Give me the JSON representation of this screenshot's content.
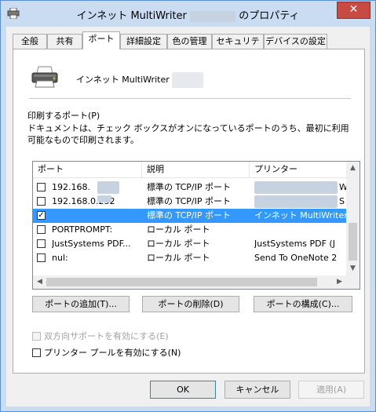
{
  "window": {
    "title_prefix": "インネット MultiWriter",
    "title_suffix": "のプロパティ",
    "close_symbol": "✕"
  },
  "tabs": [
    {
      "label": "全般"
    },
    {
      "label": "共有"
    },
    {
      "label": "ポート"
    },
    {
      "label": "詳細設定"
    },
    {
      "label": "色の管理"
    },
    {
      "label": "セキュリティ"
    },
    {
      "label": "デバイスの設定"
    }
  ],
  "printer": {
    "name": "インネット MultiWriter"
  },
  "ports_section": {
    "label": "印刷するポート(P)",
    "description": "ドキュメントは、チェック ボックスがオンになっているポートのうち、最初に利用可能なもので印刷されます。"
  },
  "port_list": {
    "headers": [
      "ポート",
      "説明",
      "プリンター"
    ],
    "rows": [
      {
        "checked": false,
        "selected": false,
        "port": "192.168.",
        "desc": "標準の TCP/IP ポート",
        "printer": "W"
      },
      {
        "checked": false,
        "selected": false,
        "port": "192.168.0.252",
        "desc": "標準の TCP/IP ポート",
        "printer": "S"
      },
      {
        "checked": true,
        "selected": true,
        "port": "",
        "desc": "標準の TCP/IP ポート",
        "printer": "インネット MultiWriter"
      },
      {
        "checked": false,
        "selected": false,
        "port": "PORTPROMPT:",
        "desc": "ローカル ポート",
        "printer": ""
      },
      {
        "checked": false,
        "selected": false,
        "port": "JustSystems PDF...",
        "desc": "ローカル ポート",
        "printer": "JustSystems PDF (J"
      },
      {
        "checked": false,
        "selected": false,
        "port": "nul:",
        "desc": "ローカル ポート",
        "printer": "Send To OneNote 2"
      }
    ]
  },
  "port_buttons": {
    "add": "ポートの追加(T)...",
    "delete": "ポートの削除(D)",
    "configure": "ポートの構成(C)..."
  },
  "options": {
    "bidirectional": {
      "label": "双方向サポートを有効にする(E)",
      "checked": false,
      "enabled": false
    },
    "pooling": {
      "label": "プリンター プールを有効にする(N)",
      "checked": false,
      "enabled": true
    }
  },
  "footer": {
    "ok": "OK",
    "cancel": "キャンセル",
    "apply": "適用(A)"
  }
}
